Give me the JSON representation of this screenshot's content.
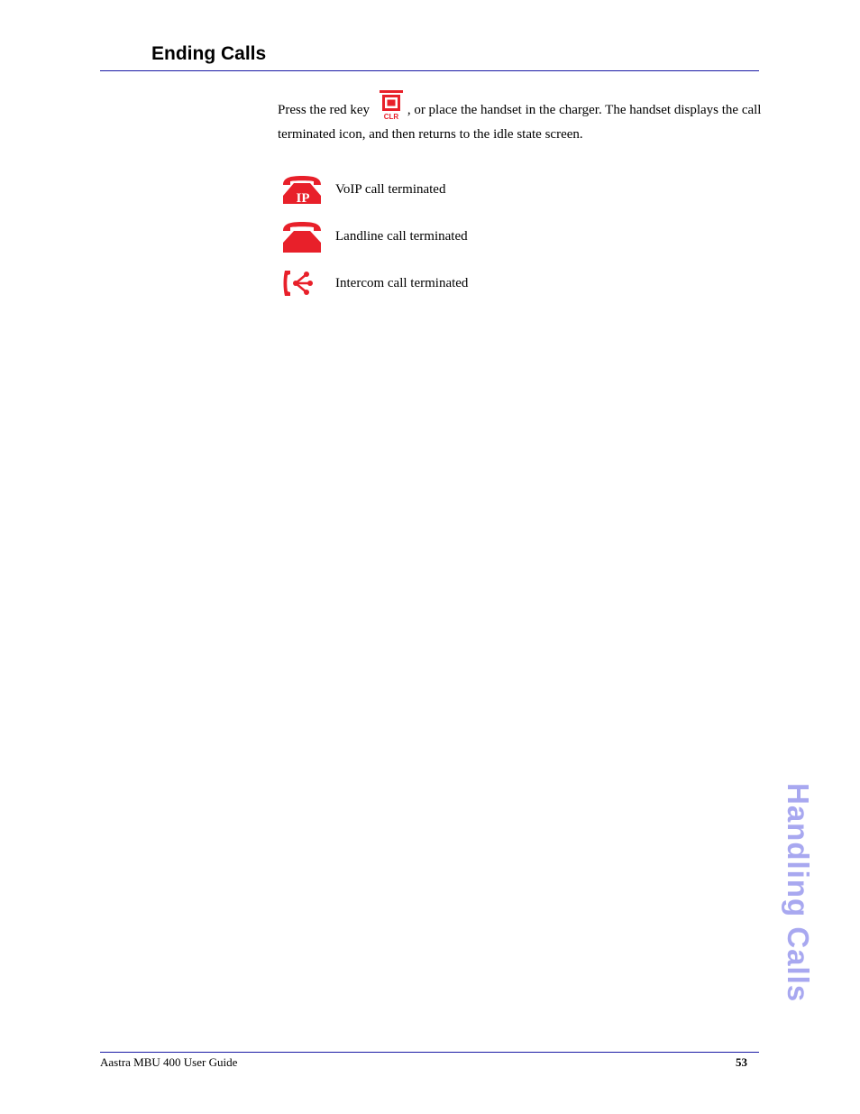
{
  "header": {
    "section_title": "Ending Calls"
  },
  "body": {
    "paragraph_before_key": "Press the red key",
    "key_icon": "clr-red-key-icon",
    "key_icon_label": "CLR",
    "paragraph_after_key": ", or place the handset in the charger. The handset displays the call terminated icon, and then returns to the idle state screen.",
    "icons": [
      {
        "icon": "voip-call-terminated-icon",
        "icon_text": "IP",
        "label": "VoIP call terminated"
      },
      {
        "icon": "landline-call-terminated-icon",
        "label": "Landline call terminated"
      },
      {
        "icon": "intercom-call-terminated-icon",
        "label": "Intercom call terminated"
      }
    ]
  },
  "side_tab": {
    "label": "Handling Calls"
  },
  "footer": {
    "guide_title": "Aastra MBU 400 User Guide",
    "page_number": "53"
  },
  "colors": {
    "accent_red": "#e8202a",
    "rule_blue": "#1a1aa6",
    "side_tab_lavender": "#a8a8f0"
  }
}
